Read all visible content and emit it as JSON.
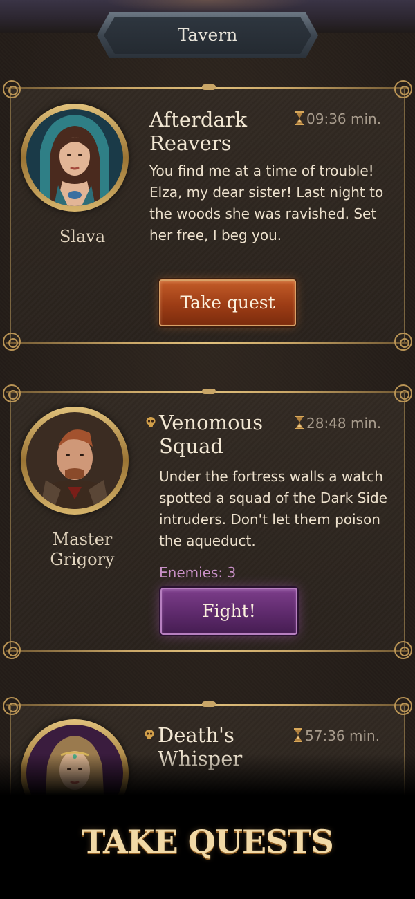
{
  "header": {
    "title": "Tavern"
  },
  "quests": [
    {
      "npc_name": "Slava",
      "title_line1": "Afterdark",
      "title_line2": "Reavers",
      "timer": "09:36 min.",
      "description": "You find me at a time of trouble! Elza, my dear sister! Last night to the woods she was ravished. Set her free, I beg you.",
      "button_label": "Take quest",
      "has_skull": false
    },
    {
      "npc_name_line1": "Master",
      "npc_name_line2": "Grigory",
      "title_line1": "Venomous",
      "title_line2": "Squad",
      "timer": "28:48 min.",
      "description": "Under the fortress walls a watch spotted a squad of the Dark Side intruders. Don't let them poison the aqueduct.",
      "enemies": "Enemies: 3",
      "button_label": "Fight!",
      "has_skull": true
    },
    {
      "title_line1": "Death's",
      "title_line2": "Whisper",
      "timer": "57:36 min.",
      "has_skull": true
    }
  ],
  "banner": {
    "text": "TAKE QUESTS"
  },
  "colors": {
    "take_button": "#9c3c15",
    "fight_button": "#5e2a6c",
    "gold_frame": "#c9a667",
    "enemies_text": "#c890c6"
  },
  "icons": [
    "hourglass-icon",
    "skull-icon"
  ]
}
